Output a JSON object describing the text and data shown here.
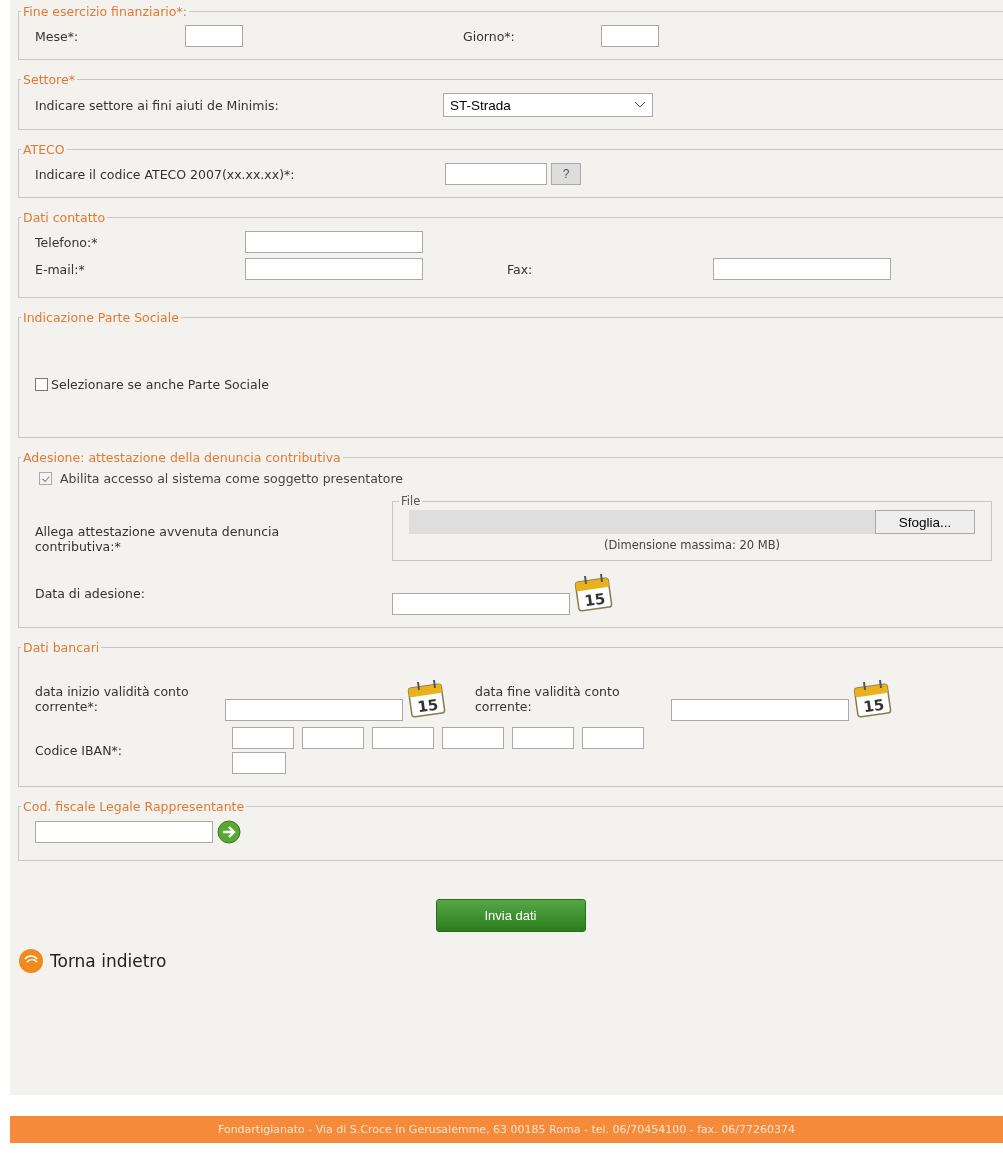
{
  "fine_esercizio": {
    "legend": "Fine esercizio finanziario*:",
    "mese_label": "Mese*:",
    "giorno_label": "Giorno*:"
  },
  "settore": {
    "legend": "Settore*",
    "label": "Indicare settore ai fini aiuti de Minimis:",
    "select_value": "ST-Strada"
  },
  "ateco": {
    "legend": "ATECO",
    "label": "Indicare il codice ATECO 2007(xx.xx.xx)*:",
    "help_button": "?"
  },
  "contatto": {
    "legend": "Dati contatto",
    "telefono_label": "Telefono:*",
    "email_label": "E-mail:*",
    "fax_label": "Fax:"
  },
  "parte_sociale": {
    "legend": "Indicazione Parte Sociale",
    "checkbox": {
      "label": "Selezionare se anche Parte Sociale",
      "checked": false
    }
  },
  "adesione": {
    "legend": "Adesione: attestazione della denuncia contributiva",
    "checkbox": {
      "label": "Abilita accesso al sistema come soggetto presentatore",
      "checked": true,
      "disabled": true
    },
    "attach_label": "Allega attestazione avvenuta denuncia contributiva:*",
    "file_legend": "File",
    "browse_button": "Sfoglia...",
    "size_note": "(Dimensione massima: 20 MB)",
    "date_label": "Data di adesione:",
    "calendar_day": "15"
  },
  "bancari": {
    "legend": "Dati bancari",
    "start_label": "data inizio validità conto corrente*:",
    "start_calendar_day": "15",
    "end_label": "data fine validità conto corrente:",
    "end_calendar_day": "15",
    "iban_label": "Codice IBAN*:"
  },
  "cod_fiscale": {
    "legend": "Cod. fiscale Legale Rappresentante"
  },
  "submit_button": "Invia dati",
  "back_link": "Torna indietro",
  "footer": "Fondartigianato - Via di S.Croce in Gerusalemme, 63 00185 Roma - tel. 06/70454100 - fax. 06/77260374"
}
